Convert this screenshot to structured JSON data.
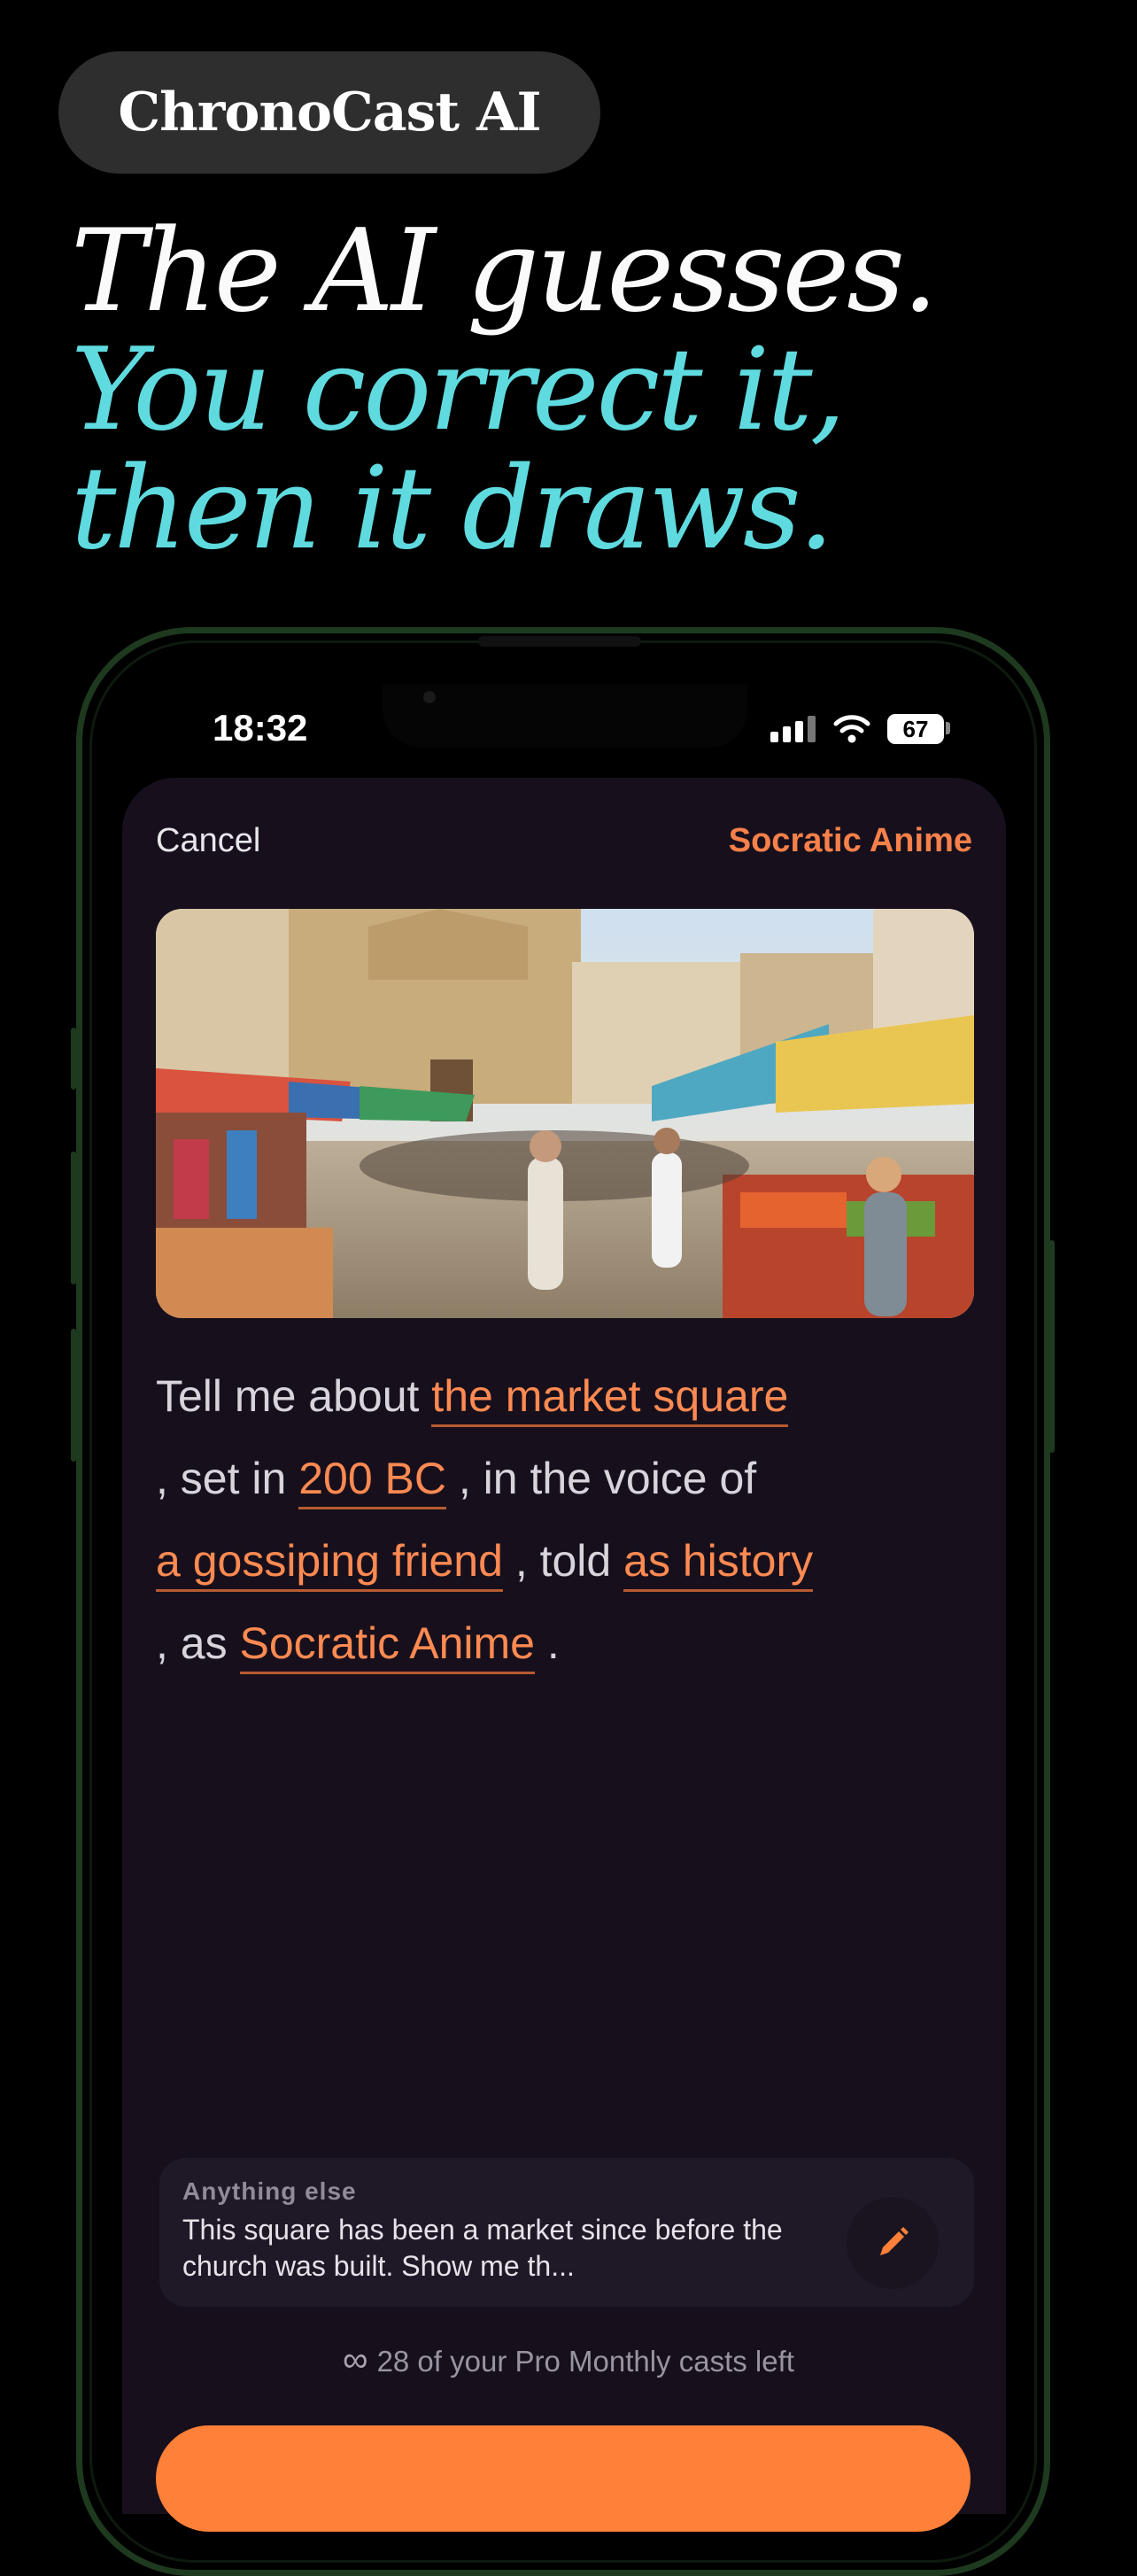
{
  "brand": {
    "name": "ChronoCast AI"
  },
  "headline": {
    "line1": "The AI guesses.",
    "line2": "You correct it,",
    "line3": "then it draws."
  },
  "status_bar": {
    "time": "18:32",
    "battery": "67"
  },
  "nav": {
    "cancel_label": "Cancel",
    "style_label": "Socratic Anime"
  },
  "prompt": {
    "t1": "Tell me about",
    "place": "the market square",
    "t2": ", set in",
    "era": "200 BC",
    "t3": ", in the voice of",
    "voice": "a gossiping friend",
    "t4": ", told",
    "mode": "as history",
    "t5": ", as",
    "style": "Socratic Anime",
    "t6": "."
  },
  "anything_else": {
    "label": "Anything else",
    "text": "This square has been a market since before the church was built. Show me th..."
  },
  "casts": {
    "icon": "∞",
    "text": "28 of your Pro Monthly casts left"
  },
  "colors": {
    "accent": "#ff8038",
    "headline_cyan": "#5fdbe0",
    "sheet_bg": "#17101c"
  },
  "icons": [
    "signal-icon",
    "wifi-icon",
    "battery-icon",
    "pencil-icon",
    "infinity-icon"
  ]
}
